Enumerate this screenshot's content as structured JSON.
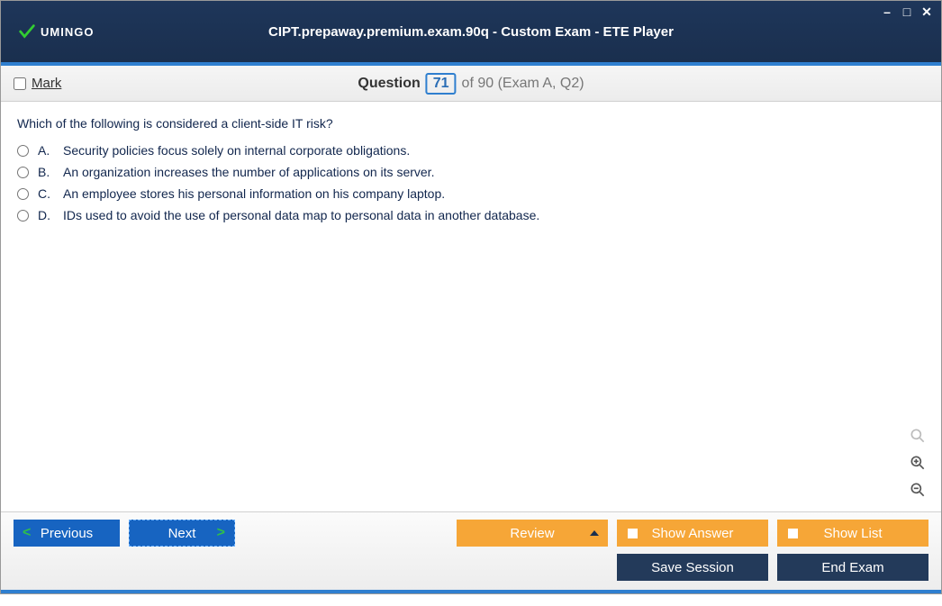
{
  "window": {
    "logo_text": "UMINGO",
    "title": "CIPT.prepaway.premium.exam.90q - Custom Exam - ETE Player"
  },
  "qbar": {
    "mark_label": "Mark",
    "question_word": "Question",
    "current": "71",
    "rest": "of 90 (Exam A, Q2)"
  },
  "question": {
    "text": "Which of the following is considered a client-side IT risk?",
    "options": [
      {
        "letter": "A.",
        "text": "Security policies focus solely on internal corporate obligations."
      },
      {
        "letter": "B.",
        "text": "An organization increases the number of applications on its server."
      },
      {
        "letter": "C.",
        "text": "An employee stores his personal information on his company laptop."
      },
      {
        "letter": "D.",
        "text": "IDs used to avoid the use of personal data map to personal data in another database."
      }
    ]
  },
  "footer": {
    "previous": "Previous",
    "next": "Next",
    "review": "Review",
    "show_answer": "Show Answer",
    "show_list": "Show List",
    "save_session": "Save Session",
    "end_exam": "End Exam"
  }
}
